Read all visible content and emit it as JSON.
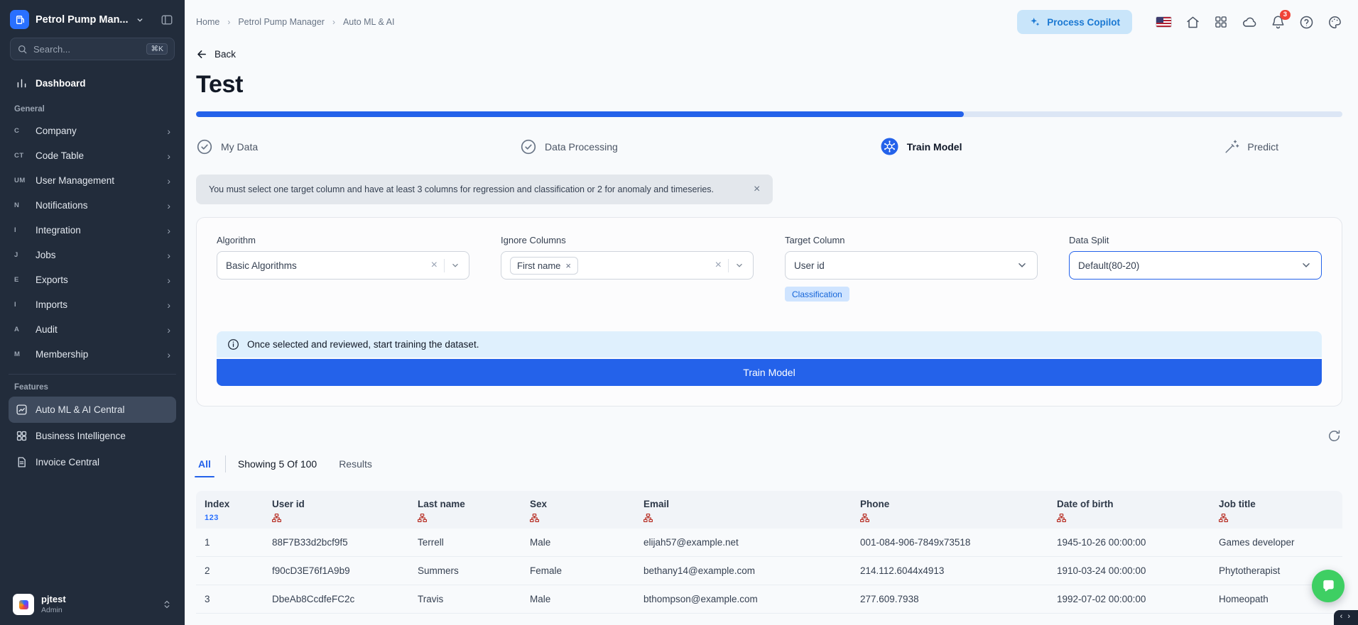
{
  "icons": {
    "close": "×",
    "chevron_right": "›",
    "breadcrumb_sep": "›",
    "corner": "‹ ›"
  },
  "colors": {
    "accent_blue": "#2462ea",
    "sidebar_bg": "#222c3b",
    "notification_red": "#f04438",
    "column_type_icon_red": "#b42318",
    "classification_badge_bg": "#cfe4ff",
    "copilot_bg": "#c9e5fa",
    "chat_fab_green": "#3ecf63"
  },
  "sidebar": {
    "app_name": "Petrol Pump Man...",
    "search": {
      "placeholder": "Search...",
      "shortcut": "⌘K"
    },
    "dashboard_label": "Dashboard",
    "general": {
      "label": "General",
      "items": [
        {
          "abbr": "C",
          "label": "Company"
        },
        {
          "abbr": "CT",
          "label": "Code Table"
        },
        {
          "abbr": "UM",
          "label": "User Management"
        },
        {
          "abbr": "N",
          "label": "Notifications"
        },
        {
          "abbr": "I",
          "label": "Integration"
        },
        {
          "abbr": "J",
          "label": "Jobs"
        },
        {
          "abbr": "E",
          "label": "Exports"
        },
        {
          "abbr": "I",
          "label": "Imports"
        },
        {
          "abbr": "A",
          "label": "Audit"
        },
        {
          "abbr": "M",
          "label": "Membership"
        }
      ]
    },
    "features": {
      "label": "Features",
      "items": [
        {
          "label": "Auto ML & AI Central"
        },
        {
          "label": "Business Intelligence"
        },
        {
          "label": "Invoice Central"
        }
      ]
    },
    "user": {
      "name": "pjtest",
      "role": "Admin"
    }
  },
  "topbar": {
    "breadcrumb": [
      "Home",
      "Petrol Pump Manager",
      "Auto ML & AI"
    ],
    "copilot_label": "Process Copilot",
    "notification_count": "3"
  },
  "page": {
    "back_label": "Back",
    "title": "Test",
    "progress_percent": 67,
    "steps": [
      {
        "label": "My Data"
      },
      {
        "label": "Data Processing"
      },
      {
        "label": "Train Model"
      },
      {
        "label": "Predict"
      }
    ],
    "alert_text": "You must select one target column and have at least 3 columns for regression and classification or 2 for anomaly and timeseries.",
    "form": {
      "algorithm_label": "Algorithm",
      "algorithm_value": "Basic Algorithms",
      "ignore_label": "Ignore Columns",
      "ignore_chip": "First name",
      "target_label": "Target Column",
      "target_value": "User id",
      "target_badge": "Classification",
      "split_label": "Data Split",
      "split_value": "Default(80-20)"
    },
    "info_text": "Once selected and reviewed, start training the dataset.",
    "train_button_label": "Train Model"
  },
  "results": {
    "tab_all_label": "All",
    "showing_text": "Showing 5 Of 100",
    "results_word": "Results",
    "table": {
      "index_type_glyph": "123",
      "columns": [
        "Index",
        "User id",
        "Last name",
        "Sex",
        "Email",
        "Phone",
        "Date of birth",
        "Job title"
      ],
      "rows": [
        [
          "1",
          "88F7B33d2bcf9f5",
          "Terrell",
          "Male",
          "elijah57@example.net",
          "001-084-906-7849x73518",
          "1945-10-26 00:00:00",
          "Games developer"
        ],
        [
          "2",
          "f90cD3E76f1A9b9",
          "Summers",
          "Female",
          "bethany14@example.com",
          "214.112.6044x4913",
          "1910-03-24 00:00:00",
          "Phytotherapist"
        ],
        [
          "3",
          "DbeAb8CcdfeFC2c",
          "Travis",
          "Male",
          "bthompson@example.com",
          "277.609.7938",
          "1992-07-02 00:00:00",
          "Homeopath"
        ]
      ]
    }
  }
}
